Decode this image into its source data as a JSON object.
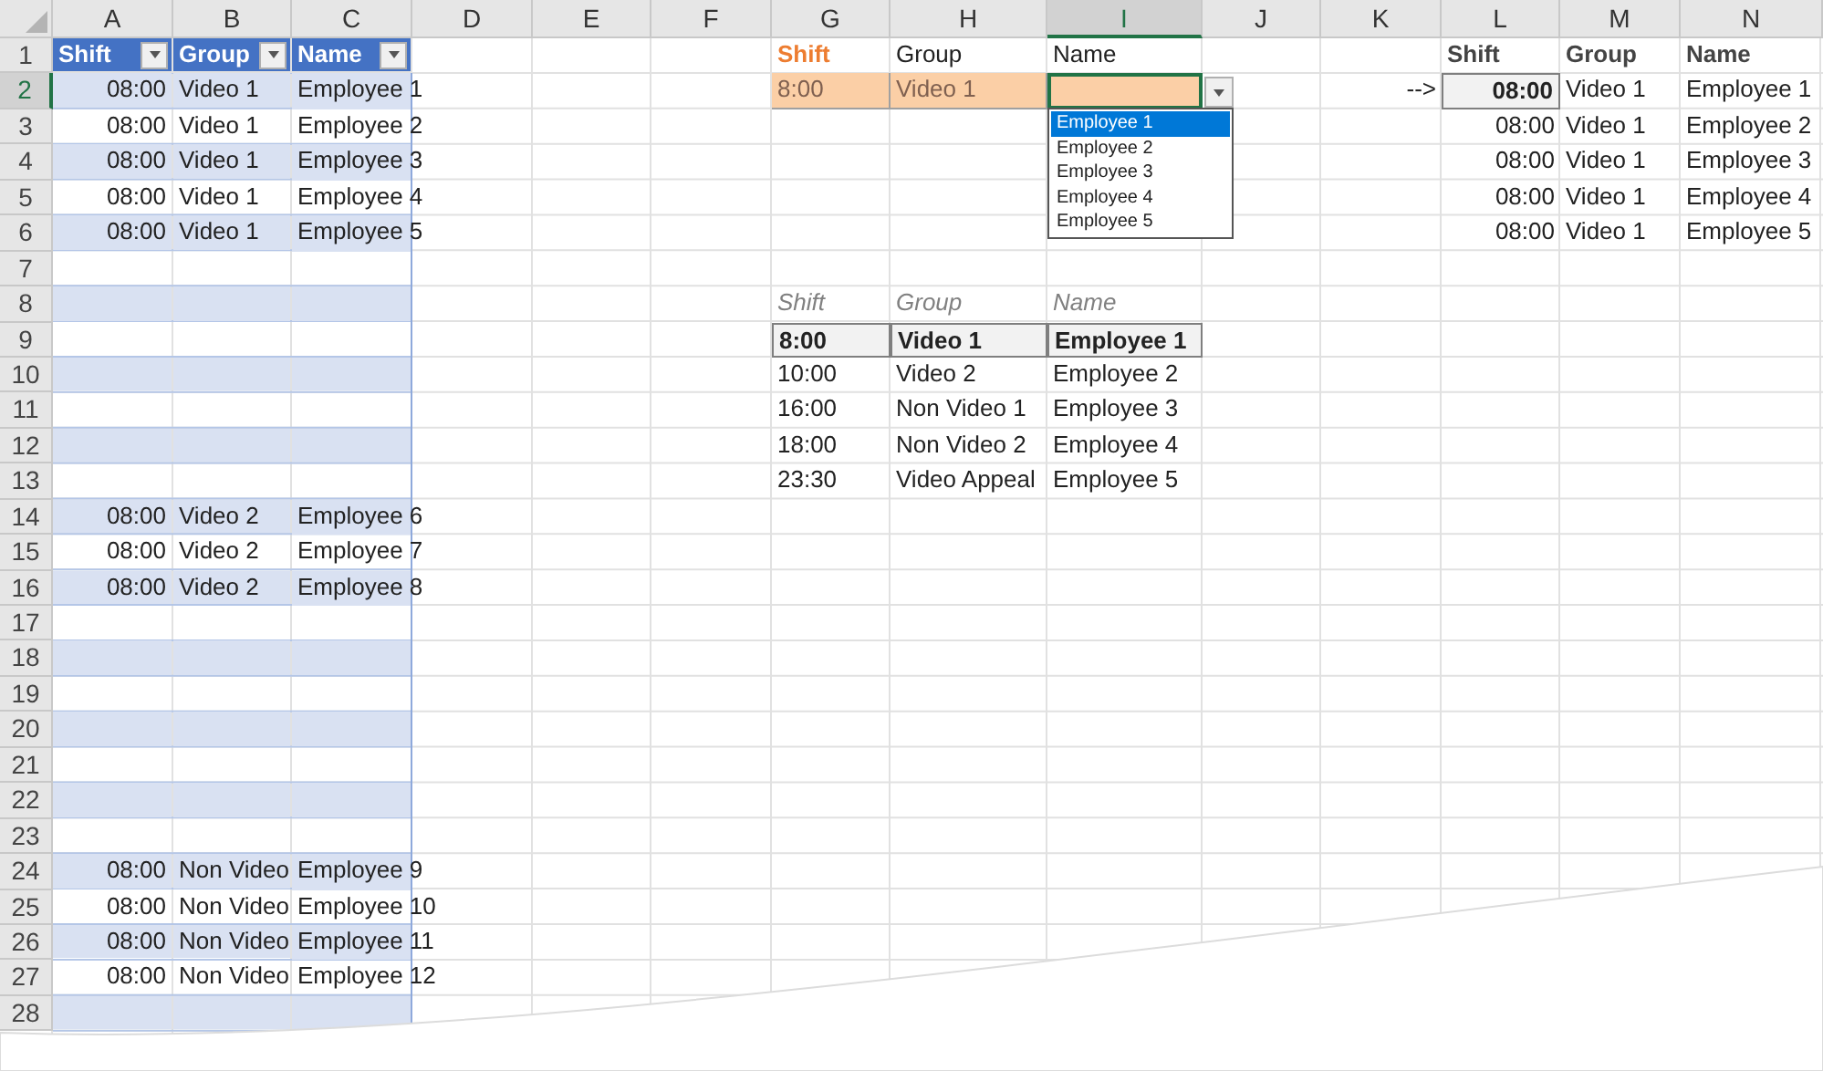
{
  "column_headers": [
    {
      "label": "A",
      "selected": false
    },
    {
      "label": "B",
      "selected": false
    },
    {
      "label": "C",
      "selected": false
    },
    {
      "label": "D",
      "selected": false
    },
    {
      "label": "E",
      "selected": false
    },
    {
      "label": "F",
      "selected": false
    },
    {
      "label": "G",
      "selected": false
    },
    {
      "label": "H",
      "selected": false
    },
    {
      "label": "I",
      "selected": true
    },
    {
      "label": "J",
      "selected": false
    },
    {
      "label": "K",
      "selected": false
    },
    {
      "label": "L",
      "selected": false
    },
    {
      "label": "M",
      "selected": false
    },
    {
      "label": "N",
      "selected": false
    }
  ],
  "row_headers": [
    {
      "label": "1",
      "selected": false
    },
    {
      "label": "2",
      "selected": true
    },
    {
      "label": "3",
      "selected": false
    },
    {
      "label": "4",
      "selected": false
    },
    {
      "label": "5",
      "selected": false
    },
    {
      "label": "6",
      "selected": false
    },
    {
      "label": "7",
      "selected": false
    },
    {
      "label": "8",
      "selected": false
    },
    {
      "label": "9",
      "selected": false
    },
    {
      "label": "10",
      "selected": false
    },
    {
      "label": "11",
      "selected": false
    },
    {
      "label": "12",
      "selected": false
    },
    {
      "label": "13",
      "selected": false
    },
    {
      "label": "14",
      "selected": false
    },
    {
      "label": "15",
      "selected": false
    },
    {
      "label": "16",
      "selected": false
    },
    {
      "label": "17",
      "selected": false
    },
    {
      "label": "18",
      "selected": false
    },
    {
      "label": "19",
      "selected": false
    },
    {
      "label": "20",
      "selected": false
    },
    {
      "label": "21",
      "selected": false
    },
    {
      "label": "22",
      "selected": false
    },
    {
      "label": "23",
      "selected": false
    },
    {
      "label": "24",
      "selected": false
    },
    {
      "label": "25",
      "selected": false
    },
    {
      "label": "26",
      "selected": false
    },
    {
      "label": "27",
      "selected": false
    },
    {
      "label": "28",
      "selected": false
    }
  ],
  "staff_table": {
    "columns": [
      "Shift",
      "Group",
      "Name"
    ],
    "rows": [
      {
        "banded": true,
        "cells": [
          "08:00",
          "Video 1",
          "Employee 1"
        ]
      },
      {
        "banded": false,
        "cells": [
          "08:00",
          "Video 1",
          "Employee 2"
        ]
      },
      {
        "banded": true,
        "cells": [
          "08:00",
          "Video 1",
          "Employee 3"
        ]
      },
      {
        "banded": false,
        "cells": [
          "08:00",
          "Video 1",
          "Employee 4"
        ]
      },
      {
        "banded": true,
        "cells": [
          "08:00",
          "Video 1",
          "Employee 5"
        ]
      },
      {
        "banded": false
      },
      {
        "banded": true
      },
      {
        "banded": false
      },
      {
        "banded": true
      },
      {
        "banded": false
      },
      {
        "banded": true
      },
      {
        "banded": false
      },
      {
        "banded": true,
        "cells": [
          "08:00",
          "Video 2",
          "Employee 6"
        ]
      },
      {
        "banded": false,
        "cells": [
          "08:00",
          "Video 2",
          "Employee 7"
        ]
      },
      {
        "banded": true,
        "cells": [
          "08:00",
          "Video 2",
          "Employee 8"
        ]
      },
      {
        "banded": false
      },
      {
        "banded": true
      },
      {
        "banded": false
      },
      {
        "banded": true
      },
      {
        "banded": false
      },
      {
        "banded": true
      },
      {
        "banded": false
      },
      {
        "banded": true,
        "cells": [
          "08:00",
          "Non Video",
          "Employee 9"
        ]
      },
      {
        "banded": false,
        "cells": [
          "08:00",
          "Non Video",
          "Employee 10"
        ]
      },
      {
        "banded": true,
        "cells": [
          "08:00",
          "Non Video",
          "Employee 11"
        ]
      },
      {
        "banded": false,
        "cells": [
          "08:00",
          "Non Video",
          "Employee 12"
        ]
      },
      {
        "banded": true
      }
    ]
  },
  "lookup": {
    "columns": [
      {
        "label": "Shift",
        "highlighted": true
      },
      {
        "label": "Group",
        "highlighted": false
      },
      {
        "label": "Name",
        "highlighted": false
      }
    ],
    "values": [
      "8:00",
      "Video 1"
    ]
  },
  "dropdown": {
    "items": [
      {
        "label": "Employee 1",
        "selected": true
      },
      {
        "label": "Employee 2",
        "selected": false
      },
      {
        "label": "Employee 3",
        "selected": false
      },
      {
        "label": "Employee 4",
        "selected": false
      },
      {
        "label": "Employee 5",
        "selected": false
      }
    ]
  },
  "reference_list": {
    "columns": [
      "Shift",
      "Group",
      "Name"
    ],
    "rows": [
      {
        "highlighted": true,
        "cells": [
          "8:00",
          "Video 1",
          "Employee 1"
        ]
      },
      {
        "highlighted": false,
        "cells": [
          "10:00",
          "Video 2",
          "Employee 2"
        ]
      },
      {
        "highlighted": false,
        "cells": [
          "16:00",
          "Non Video 1",
          "Employee 3"
        ]
      },
      {
        "highlighted": false,
        "cells": [
          "18:00",
          "Non Video 2",
          "Employee 4"
        ]
      },
      {
        "highlighted": false,
        "cells": [
          "23:30",
          "Video Appeal",
          "Employee 5"
        ]
      }
    ]
  },
  "arrow": "-->",
  "result_table": {
    "columns": [
      "Shift",
      "Group",
      "Name"
    ],
    "rows": [
      {
        "highlighted": true,
        "cells": [
          "08:00",
          "Video 1",
          "Employee 1"
        ]
      },
      {
        "highlighted": false,
        "cells": [
          "08:00",
          "Video 1",
          "Employee 2"
        ]
      },
      {
        "highlighted": false,
        "cells": [
          "08:00",
          "Video 1",
          "Employee 3"
        ]
      },
      {
        "highlighted": false,
        "cells": [
          "08:00",
          "Video 1",
          "Employee 4"
        ]
      },
      {
        "highlighted": false,
        "cells": [
          "08:00",
          "Video 1",
          "Employee 5"
        ]
      }
    ]
  }
}
